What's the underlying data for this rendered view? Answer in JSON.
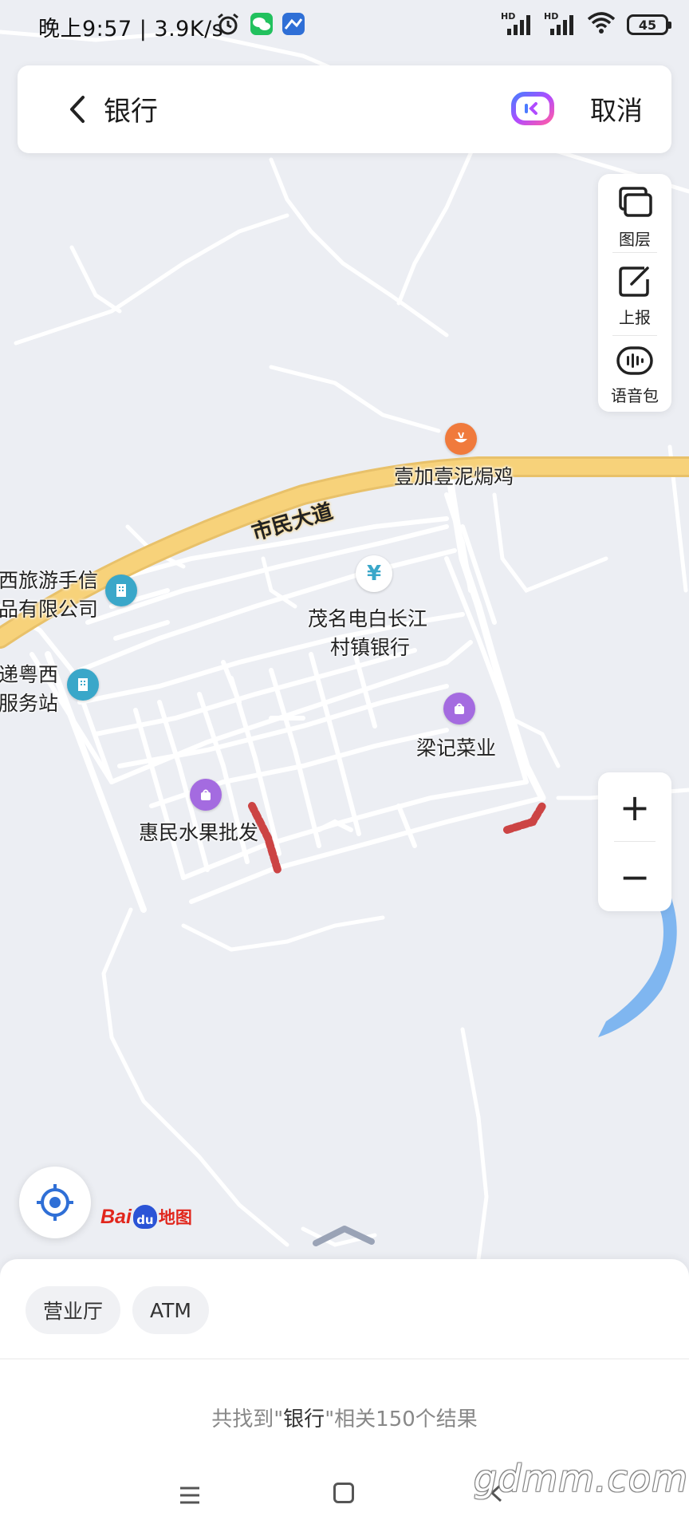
{
  "status_bar": {
    "time": "晚上9:57",
    "net_speed": "3.9K/s",
    "signal_1": "HD",
    "signal_2": "HD",
    "battery": "45"
  },
  "search": {
    "query": "银行",
    "cancel_label": "取消"
  },
  "tools": {
    "layers_label": "图层",
    "report_label": "上报",
    "voice_label": "语音包"
  },
  "zoom": {
    "in_label": "+",
    "out_label": "−"
  },
  "map": {
    "road_main": "市民大道",
    "poi_restaurant": "壹加壹泥焗鸡",
    "poi_bank_line1": "茂名电白长江",
    "poi_bank_line2": "村镇银行",
    "poi_travel_line1": "西旅游手信",
    "poi_travel_line2": "品有限公司",
    "poi_express_line1": "递粤西",
    "poi_express_line2": "服务站",
    "poi_veg": "梁记菜业",
    "poi_fruit": "惠民水果批发"
  },
  "logo": {
    "bai": "Bai",
    "du": "du",
    "ditu": "地图"
  },
  "sheet": {
    "chips": [
      "营业厅",
      "ATM"
    ],
    "result_prefix": "共找到\"",
    "result_keyword": "银行",
    "result_suffix": "\"相关150个结果"
  },
  "watermark": "gdmm.com",
  "colors": {
    "main_road": "#f7d27a",
    "water": "#7fb6f0",
    "poi_restaurant": "#f07a3c",
    "poi_shop": "#a46be0",
    "poi_building": "#3aa7c9"
  }
}
